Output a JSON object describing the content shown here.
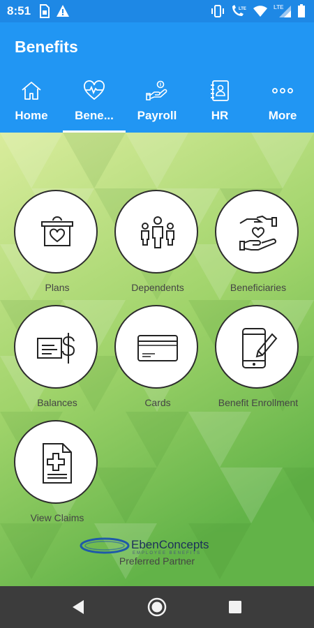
{
  "status_bar": {
    "time": "8:51",
    "left_icons": [
      "sim-card-icon",
      "warning-icon"
    ],
    "right_icons": [
      "vibrate-icon",
      "wifi-calling-lte-icon",
      "wifi-icon",
      "signal-lte-icon",
      "battery-icon"
    ],
    "network_label": "LTE"
  },
  "app_bar": {
    "title": "Benefits",
    "color": "#2196f3"
  },
  "tabs": [
    {
      "label": "Home",
      "icon": "home-icon",
      "active": false
    },
    {
      "label": "Bene...",
      "icon": "heart-pulse-icon",
      "active": true
    },
    {
      "label": "Payroll",
      "icon": "hand-coin-icon",
      "active": false
    },
    {
      "label": "HR",
      "icon": "contact-book-icon",
      "active": false
    },
    {
      "label": "More",
      "icon": "more-dots-icon",
      "active": false
    }
  ],
  "tiles": [
    {
      "label": "Plans",
      "icon": "bag-heart-icon"
    },
    {
      "label": "Dependents",
      "icon": "family-icon"
    },
    {
      "label": "Beneficiaries",
      "icon": "hands-heart-icon"
    },
    {
      "label": "Balances",
      "icon": "dollar-document-icon"
    },
    {
      "label": "Cards",
      "icon": "credit-card-icon"
    },
    {
      "label": "Benefit Enrollment",
      "icon": "phone-pen-icon"
    },
    {
      "label": "View Claims",
      "icon": "medical-document-icon"
    }
  ],
  "partner": {
    "logo_text": "EbenConcepts",
    "logo_subtext": "EMPLOYEE BENEFITS",
    "caption": "Preferred Partner"
  },
  "nav_bar": {
    "buttons": [
      "back-icon",
      "home-circle-icon",
      "recents-icon"
    ]
  }
}
